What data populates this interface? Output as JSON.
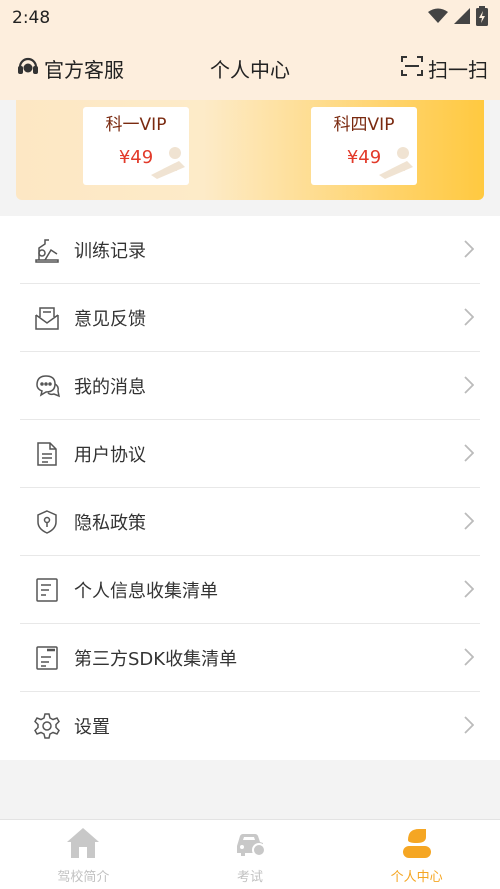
{
  "status_bar": {
    "time": "2:48",
    "icons": [
      "wifi-icon",
      "signal-icon",
      "battery-icon"
    ]
  },
  "header": {
    "left_label": "官方客服",
    "title": "个人中心",
    "right_label": "扫一扫",
    "left_icon": "headset-icon",
    "right_icon": "scan-icon"
  },
  "banner": {
    "cards": [
      {
        "name": "科一VIP",
        "price": "¥49"
      },
      {
        "name": "科四VIP",
        "price": "¥49"
      }
    ]
  },
  "menu": {
    "items": [
      {
        "label": "训练记录",
        "icon": "training-record-icon"
      },
      {
        "label": "意见反馈",
        "icon": "feedback-icon"
      },
      {
        "label": "我的消息",
        "icon": "message-icon"
      },
      {
        "label": "用户协议",
        "icon": "document-icon"
      },
      {
        "label": "隐私政策",
        "icon": "shield-icon"
      },
      {
        "label": "个人信息收集清单",
        "icon": "list-icon"
      },
      {
        "label": "第三方SDK收集清单",
        "icon": "sdk-list-icon"
      },
      {
        "label": "设置",
        "icon": "gear-icon"
      }
    ]
  },
  "tabbar": {
    "tabs": [
      {
        "label": "驾校简介",
        "icon": "home-icon",
        "active": false
      },
      {
        "label": "考试",
        "icon": "car-icon",
        "active": false
      },
      {
        "label": "个人中心",
        "icon": "person-icon",
        "active": true
      }
    ]
  },
  "colors": {
    "header_bg": "#fdeedd",
    "accent": "#f5a623",
    "price": "#e23a2a"
  }
}
